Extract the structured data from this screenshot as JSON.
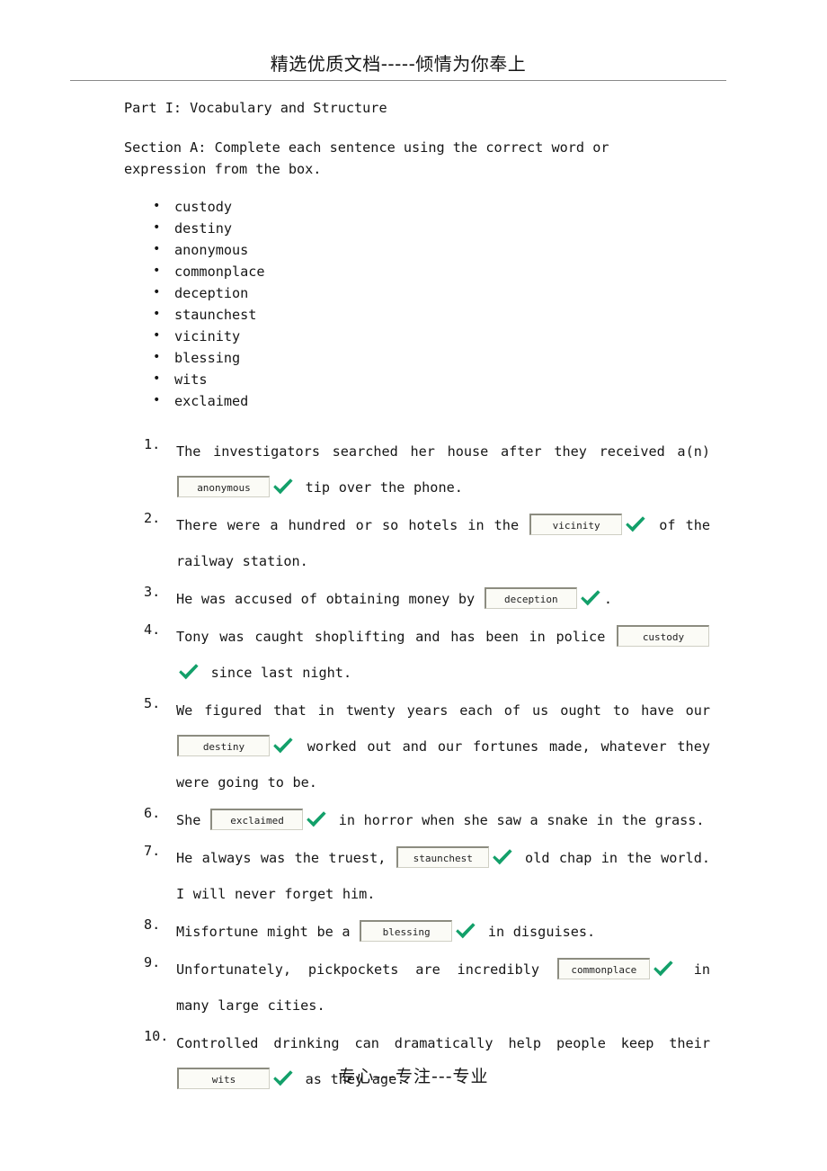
{
  "document": {
    "header_title": "精选优质文档-----倾情为你奉上",
    "footer_text": "专心---专注---专业",
    "part_title": "Part I: Vocabulary and Structure",
    "section_instruction": "Section A: Complete each sentence using the correct word or expression from the box."
  },
  "colors": {
    "check_green": "#13a06a",
    "box_fill": "#fbfbf6",
    "box_border_dark": "#8c8c80",
    "box_border_light": "#cfcfc4",
    "text": "#161616",
    "rule": "#8a8a8a"
  },
  "word_box": {
    "words": [
      "custody",
      "destiny",
      "anonymous",
      "commonplace",
      "deception",
      "staunchest",
      "vicinity",
      "blessing",
      "wits",
      "exclaimed"
    ]
  },
  "questions": [
    {
      "number": "1.",
      "before": "The investigators searched her house after they received a(n)",
      "answer": "anonymous",
      "after": "tip over the phone.",
      "box_starts_line": false,
      "checked": true
    },
    {
      "number": "2.",
      "before": "There were a hundred or so hotels in the",
      "answer": "vicinity",
      "after": "of the railway station.",
      "box_starts_line": false,
      "checked": true
    },
    {
      "number": "3.",
      "before": "He was accused of obtaining money by",
      "answer": "deception",
      "after": ".",
      "box_starts_line": false,
      "checked": true
    },
    {
      "number": "4.",
      "before": "Tony was caught shoplifting and has been in police",
      "answer": "custody",
      "after": "since last night.",
      "box_starts_line": false,
      "checked": true
    },
    {
      "number": "5.",
      "before": "We figured that in twenty years each of us ought to have our",
      "answer": "destiny",
      "after": "worked out and our fortunes made, whatever they were going to be.",
      "box_starts_line": false,
      "checked": true
    },
    {
      "number": "6.",
      "before": "She",
      "answer": "exclaimed",
      "after": "in horror when she saw a snake in the grass.",
      "box_starts_line": false,
      "checked": true
    },
    {
      "number": "7.",
      "before": "He always was the truest,",
      "answer": "staunchest",
      "after": "old chap in the world. I will never forget him.",
      "box_starts_line": false,
      "checked": true
    },
    {
      "number": "8.",
      "before": "Misfortune might be a",
      "answer": "blessing",
      "after": "in disguises.",
      "box_starts_line": false,
      "checked": true
    },
    {
      "number": "9.",
      "before": "Unfortunately, pickpockets are incredibly",
      "answer": "commonplace",
      "after": "in many large cities.",
      "box_starts_line": false,
      "checked": true
    },
    {
      "number": "10.",
      "before": "Controlled drinking can dramatically help people keep their",
      "answer": "wits",
      "after": "as they age.",
      "box_starts_line": false,
      "checked": true
    }
  ]
}
